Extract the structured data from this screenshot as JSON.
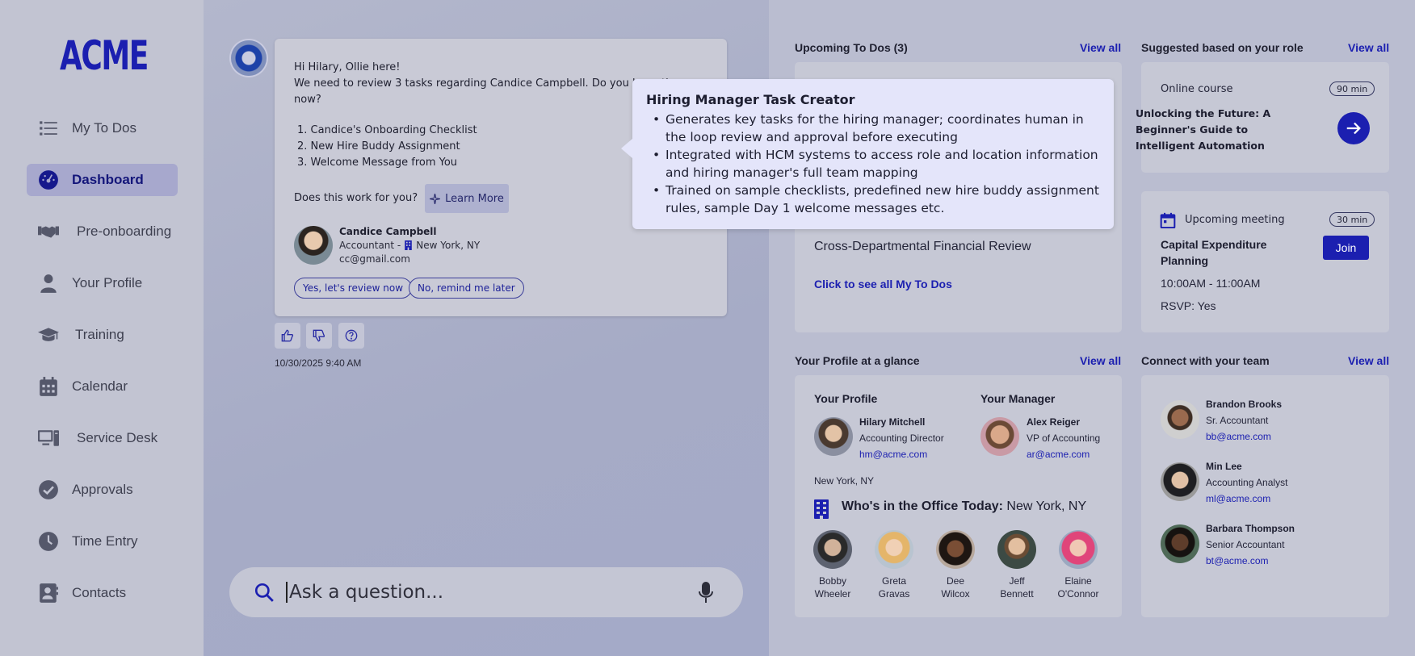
{
  "app": {
    "logo": "ACME"
  },
  "sidebar": {
    "items": [
      {
        "label": "My To Dos",
        "icon": "list-icon"
      },
      {
        "label": "Dashboard",
        "icon": "dashboard-icon",
        "active": true
      },
      {
        "label": "Pre-onboarding",
        "icon": "handshake-icon"
      },
      {
        "label": "Your Profile",
        "icon": "person-icon"
      },
      {
        "label": "Training",
        "icon": "graduation-cap-icon"
      },
      {
        "label": "Calendar",
        "icon": "calendar-icon"
      },
      {
        "label": "Service Desk",
        "icon": "desktop-icon"
      },
      {
        "label": "Approvals",
        "icon": "check-circle-icon"
      },
      {
        "label": "Time Entry",
        "icon": "clock-icon"
      },
      {
        "label": "Contacts",
        "icon": "contacts-icon"
      }
    ]
  },
  "chat": {
    "greeting": "Hi Hilary, Ollie here!",
    "message_line1": "We need to review 3 tasks regarding Candice Campbell. Do you have time",
    "message_line2": "now?",
    "tasks": [
      "1. Candice's Onboarding Checklist",
      "2. New Hire Buddy Assignment",
      "3. Welcome Message from You"
    ],
    "question": "Does this work for you?",
    "learn_more": "Learn More",
    "candidate": {
      "name": "Candice Campbell",
      "role": "Accountant -",
      "location": "New York, NY",
      "email": "cc@gmail.com"
    },
    "yes_label": "Yes, let's review now",
    "no_label": "No, remind me later",
    "timestamp": "10/30/2025 9:40 AM",
    "ask_placeholder": "Ask a question..."
  },
  "tooltip": {
    "title": "Hiring Manager Task Creator",
    "bullets": [
      "Generates key tasks for the hiring manager; coordinates human in the loop review and approval before executing",
      "Integrated with HCM systems to access role and location information and hiring manager's full team mapping",
      "Trained on sample checklists, predefined new hire buddy assignment rules, sample Day 1 welcome messages etc."
    ]
  },
  "todos": {
    "title": "Upcoming To Dos (3)",
    "view_all": "View all",
    "item": "Cross-Departmental Financial Review",
    "link": "Click to see all My To Dos"
  },
  "suggested": {
    "title": "Suggested based on your role",
    "view_all": "View all",
    "type": "Online course",
    "duration": "90 min",
    "course_title": "Unlocking the Future: A Beginner's Guide to Intelligent Automation"
  },
  "meeting": {
    "label": "Upcoming meeting",
    "duration": "30 min",
    "title": "Capital Expenditure Planning",
    "join": "Join",
    "time": "10:00AM - 11:00AM",
    "rsvp": "RSVP: Yes"
  },
  "profile": {
    "title": "Your Profile at a glance",
    "view_all": "View all",
    "your_profile": "Your Profile",
    "your_manager": "Your Manager",
    "me": {
      "name": "Hilary Mitchell",
      "role": "Accounting Director",
      "email": "hm@acme.com"
    },
    "manager": {
      "name": "Alex Reiger",
      "role": "VP of Accounting",
      "email": "ar@acme.com"
    },
    "location": "New York, NY",
    "office_label": "Who's in the Office Today:",
    "office_location": "New York, NY",
    "office_people": [
      {
        "first": "Bobby",
        "last": "Wheeler"
      },
      {
        "first": "Greta",
        "last": "Gravas"
      },
      {
        "first": "Dee",
        "last": "Wilcox"
      },
      {
        "first": "Jeff",
        "last": "Bennett"
      },
      {
        "first": "Elaine",
        "last": "O'Connor"
      }
    ]
  },
  "team": {
    "title": "Connect with your team",
    "view_all": "View all",
    "members": [
      {
        "name": "Brandon Brooks",
        "role": "Sr. Accountant",
        "email": "bb@acme.com"
      },
      {
        "name": "Min Lee",
        "role": "Accounting Analyst",
        "email": "ml@acme.com"
      },
      {
        "name": "Barbara Thompson",
        "role": "Senior Accountant",
        "email": "bt@acme.com"
      }
    ]
  },
  "colors": {
    "brand": "#1b1fb0",
    "tooltip_bg": "#e4e5fa",
    "active_nav": "#a7a8cd"
  }
}
